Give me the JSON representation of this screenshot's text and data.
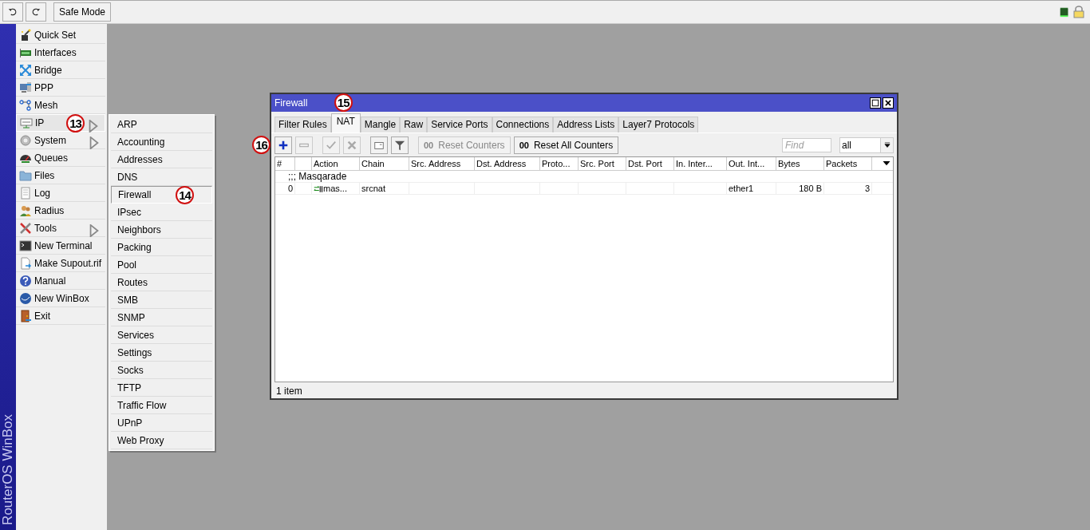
{
  "topbar": {
    "safe_mode": "Safe Mode"
  },
  "brand": "RouterOS WinBox",
  "menu": [
    {
      "label": "Quick Set",
      "submenu": false,
      "selected": false
    },
    {
      "label": "Interfaces",
      "submenu": false,
      "selected": false
    },
    {
      "label": "Bridge",
      "submenu": false,
      "selected": false
    },
    {
      "label": "PPP",
      "submenu": false,
      "selected": false
    },
    {
      "label": "Mesh",
      "submenu": false,
      "selected": false
    },
    {
      "label": "IP",
      "submenu": true,
      "selected": true,
      "callout": "13"
    },
    {
      "label": "System",
      "submenu": true,
      "selected": false
    },
    {
      "label": "Queues",
      "submenu": false,
      "selected": false
    },
    {
      "label": "Files",
      "submenu": false,
      "selected": false
    },
    {
      "label": "Log",
      "submenu": false,
      "selected": false
    },
    {
      "label": "Radius",
      "submenu": false,
      "selected": false
    },
    {
      "label": "Tools",
      "submenu": true,
      "selected": false
    },
    {
      "label": "New Terminal",
      "submenu": false,
      "selected": false
    },
    {
      "label": "Make Supout.rif",
      "submenu": false,
      "selected": false
    },
    {
      "label": "Manual",
      "submenu": false,
      "selected": false
    },
    {
      "label": "New WinBox",
      "submenu": false,
      "selected": false
    },
    {
      "label": "Exit",
      "submenu": false,
      "selected": false
    }
  ],
  "submenu": [
    {
      "label": "ARP",
      "selected": false
    },
    {
      "label": "Accounting",
      "selected": false
    },
    {
      "label": "Addresses",
      "selected": false
    },
    {
      "label": "DNS",
      "selected": false
    },
    {
      "label": "Firewall",
      "selected": true,
      "callout": "14"
    },
    {
      "label": "IPsec",
      "selected": false
    },
    {
      "label": "Neighbors",
      "selected": false
    },
    {
      "label": "Packing",
      "selected": false
    },
    {
      "label": "Pool",
      "selected": false
    },
    {
      "label": "Routes",
      "selected": false
    },
    {
      "label": "SMB",
      "selected": false
    },
    {
      "label": "SNMP",
      "selected": false
    },
    {
      "label": "Services",
      "selected": false
    },
    {
      "label": "Settings",
      "selected": false
    },
    {
      "label": "Socks",
      "selected": false
    },
    {
      "label": "TFTP",
      "selected": false
    },
    {
      "label": "Traffic Flow",
      "selected": false
    },
    {
      "label": "UPnP",
      "selected": false
    },
    {
      "label": "Web Proxy",
      "selected": false
    }
  ],
  "window": {
    "title": "Firewall",
    "tabs": [
      {
        "label": "Filter Rules",
        "selected": false
      },
      {
        "label": "NAT",
        "selected": true,
        "callout": "15"
      },
      {
        "label": "Mangle",
        "selected": false
      },
      {
        "label": "Raw",
        "selected": false
      },
      {
        "label": "Service Ports",
        "selected": false
      },
      {
        "label": "Connections",
        "selected": false
      },
      {
        "label": "Address Lists",
        "selected": false
      },
      {
        "label": "Layer7 Protocols",
        "selected": false
      }
    ],
    "tools": [
      {
        "kind": "add",
        "disabled": false,
        "callout": "16"
      },
      {
        "kind": "remove",
        "disabled": true
      },
      {
        "kind": "enable",
        "disabled": true
      },
      {
        "kind": "disable",
        "disabled": true
      },
      {
        "kind": "comment",
        "disabled": false
      },
      {
        "kind": "filter",
        "disabled": false
      },
      {
        "kind": "text",
        "prefix": "00",
        "label": "Reset Counters",
        "disabled": true
      },
      {
        "kind": "text",
        "prefix": "00",
        "label": "Reset All Counters",
        "disabled": false
      }
    ],
    "find": {
      "placeholder": "Find"
    },
    "scope": {
      "value": "all"
    },
    "columns": [
      {
        "kind": "text",
        "label": "#"
      },
      {
        "kind": "flag"
      },
      {
        "kind": "text",
        "label": "Action"
      },
      {
        "kind": "text",
        "label": "Chain"
      },
      {
        "kind": "text",
        "label": "Src. Address"
      },
      {
        "kind": "text",
        "label": "Dst. Address"
      },
      {
        "kind": "text",
        "label": "Proto..."
      },
      {
        "kind": "text",
        "label": "Src. Port"
      },
      {
        "kind": "text",
        "label": "Dst. Port"
      },
      {
        "kind": "text",
        "label": "In. Inter..."
      },
      {
        "kind": "text",
        "label": "Out. Int..."
      },
      {
        "kind": "text",
        "label": "Bytes"
      },
      {
        "kind": "text",
        "label": "Packets"
      },
      {
        "kind": "menu"
      }
    ],
    "rows": [
      {
        "kind": "comment",
        "text": ";;; Masqarade"
      },
      {
        "kind": "rule",
        "cells": [
          "0",
          null,
          "mas...",
          "srcnat",
          null,
          null,
          null,
          null,
          null,
          null,
          "ether1",
          "180 B",
          "3"
        ]
      }
    ],
    "status": "1 item"
  }
}
